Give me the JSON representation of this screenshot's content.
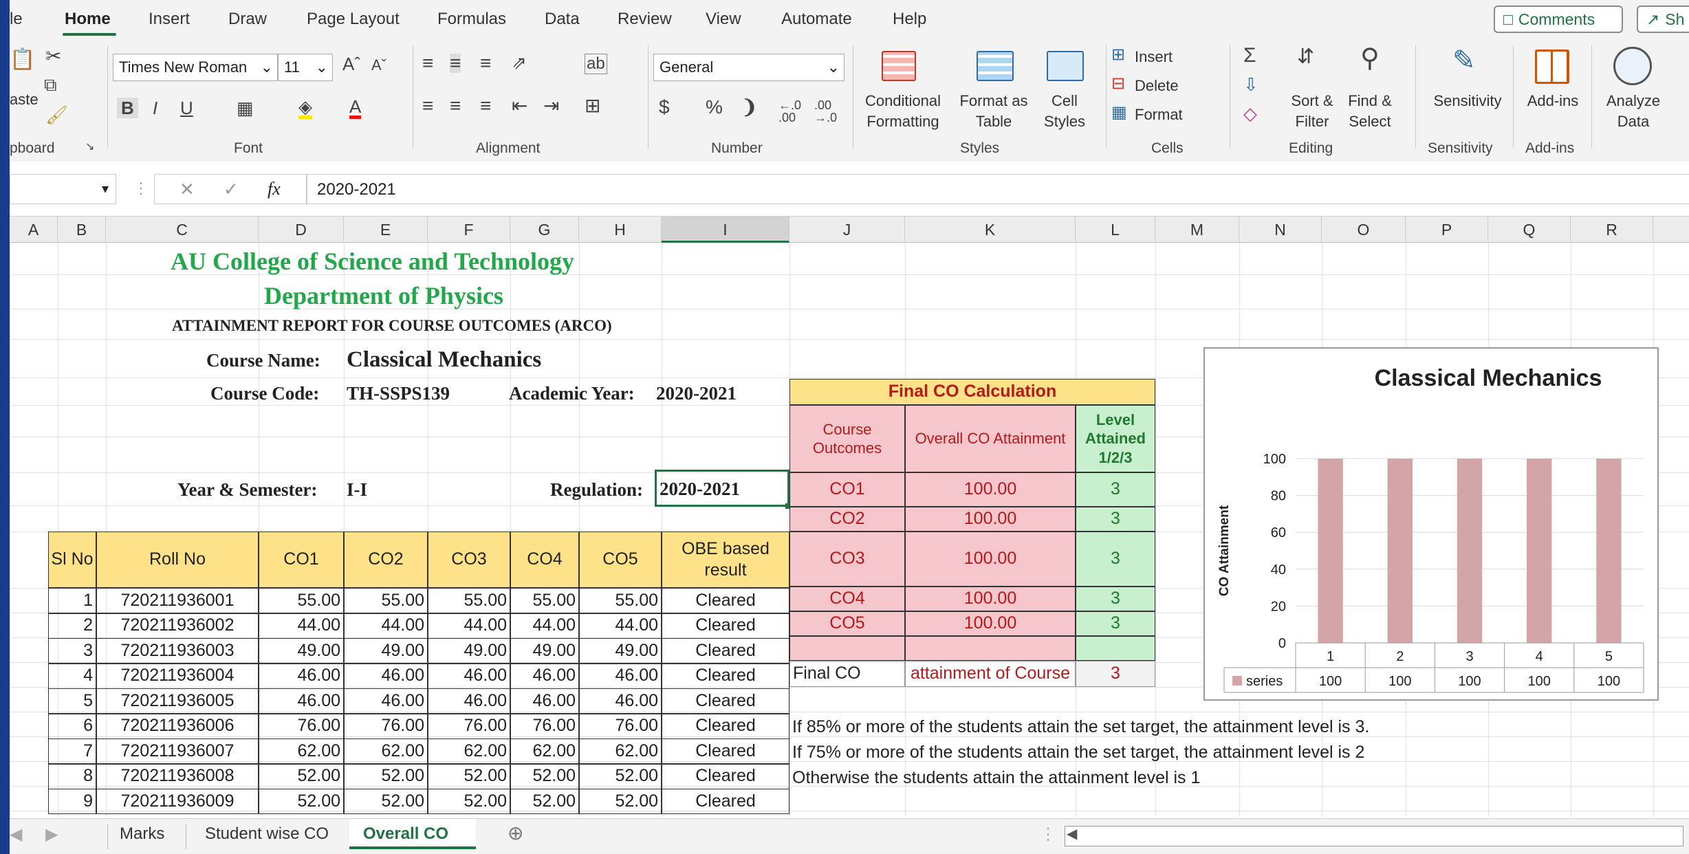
{
  "ribbon_tabs": [
    "le",
    "Home",
    "Insert",
    "Draw",
    "Page Layout",
    "Formulas",
    "Data",
    "Review",
    "View",
    "Automate",
    "Help"
  ],
  "top_buttons": {
    "comments": "Comments",
    "share": "Sh"
  },
  "font": {
    "name": "Times New Roman",
    "size": "11"
  },
  "number_format": "General",
  "groups": {
    "clipboard": "pboard",
    "font": "Font",
    "alignment": "Alignment",
    "number": "Number",
    "styles": "Styles",
    "cells": "Cells",
    "editing": "Editing",
    "sensitivity": "Sensitivity",
    "addins": "Add-ins"
  },
  "ribbon_buttons": {
    "paste": "aste",
    "cond1": "Conditional",
    "cond2": "Formatting",
    "fmt_table1": "Format as",
    "fmt_table2": "Table",
    "cell_styles1": "Cell",
    "cell_styles2": "Styles",
    "insert": "Insert",
    "delete": "Delete",
    "format": "Format",
    "sort1": "Sort &",
    "sort2": "Filter",
    "find1": "Find &",
    "find2": "Select",
    "sensitivity": "Sensitivity",
    "addins": "Add-ins",
    "analyze1": "Analyze",
    "analyze2": "Data"
  },
  "formula": {
    "value": "2020-2021",
    "fx": "fx"
  },
  "columns": [
    "A",
    "B",
    "C",
    "D",
    "E",
    "F",
    "G",
    "H",
    "I",
    "J",
    "K",
    "L",
    "M",
    "N",
    "O",
    "P",
    "Q",
    "R"
  ],
  "header": {
    "college": "AU College of Science and Technology",
    "dept": "Department of Physics",
    "report": "ATTAINMENT REPORT FOR COURSE OUTCOMES (ARCO)",
    "course_name_label": "Course Name:",
    "course_name": "Classical Mechanics",
    "course_code_label": "Course Code:",
    "course_code": "TH-SSPS139",
    "academic_year_label": "Academic Year:",
    "academic_year": "2020-2021",
    "year_sem_label": "Year & Semester:",
    "year_sem": "I-I",
    "regulation_label": "Regulation:",
    "regulation": "2020-2021"
  },
  "table_headers": [
    "Sl No",
    "Roll No",
    "CO1",
    "CO2",
    "CO3",
    "CO4",
    "CO5",
    "OBE based result"
  ],
  "students": [
    {
      "sl": "1",
      "roll": "720211936001",
      "co": [
        "55.00",
        "55.00",
        "55.00",
        "55.00",
        "55.00"
      ],
      "result": "Cleared"
    },
    {
      "sl": "2",
      "roll": "720211936002",
      "co": [
        "44.00",
        "44.00",
        "44.00",
        "44.00",
        "44.00"
      ],
      "result": "Cleared"
    },
    {
      "sl": "3",
      "roll": "720211936003",
      "co": [
        "49.00",
        "49.00",
        "49.00",
        "49.00",
        "49.00"
      ],
      "result": "Cleared"
    },
    {
      "sl": "4",
      "roll": "720211936004",
      "co": [
        "46.00",
        "46.00",
        "46.00",
        "46.00",
        "46.00"
      ],
      "result": "Cleared"
    },
    {
      "sl": "5",
      "roll": "720211936005",
      "co": [
        "46.00",
        "46.00",
        "46.00",
        "46.00",
        "46.00"
      ],
      "result": "Cleared"
    },
    {
      "sl": "6",
      "roll": "720211936006",
      "co": [
        "76.00",
        "76.00",
        "76.00",
        "76.00",
        "76.00"
      ],
      "result": "Cleared"
    },
    {
      "sl": "7",
      "roll": "720211936007",
      "co": [
        "62.00",
        "62.00",
        "62.00",
        "62.00",
        "62.00"
      ],
      "result": "Cleared"
    },
    {
      "sl": "8",
      "roll": "720211936008",
      "co": [
        "52.00",
        "52.00",
        "52.00",
        "52.00",
        "52.00"
      ],
      "result": "Cleared"
    },
    {
      "sl": "9",
      "roll": "720211936009",
      "co": [
        "52.00",
        "52.00",
        "52.00",
        "52.00",
        "52.00"
      ],
      "result": "Cleared"
    }
  ],
  "final": {
    "title": "Final CO Calculation",
    "h1": "Course Outcomes",
    "h2": "Overall CO Attainment",
    "h3": "Level Attained 1/2/3",
    "rows": [
      {
        "co": "CO1",
        "att": "100.00",
        "lvl": "3"
      },
      {
        "co": "CO2",
        "att": "100.00",
        "lvl": "3"
      },
      {
        "co": "CO3",
        "att": "100.00",
        "lvl": "3"
      },
      {
        "co": "CO4",
        "att": "100.00",
        "lvl": "3"
      },
      {
        "co": "CO5",
        "att": "100.00",
        "lvl": "3"
      }
    ],
    "final_label": "Final CO",
    "final_text": "attainment of Course",
    "final_value": "3"
  },
  "notes": [
    "If 85% or more of the students attain the set target, the attainment level is 3.",
    "If 75% or more of the students attain the set target, the attainment level is 2",
    "Otherwise the students attain the attainment level is 1"
  ],
  "chart": {
    "title": "Classical Mechanics",
    "ylabel": "CO Attainment",
    "series_name": "series",
    "categories": [
      "1",
      "2",
      "3",
      "4",
      "5"
    ],
    "values": [
      100,
      100,
      100,
      100,
      100
    ],
    "value_labels": [
      "100",
      "100",
      "100",
      "100",
      "100"
    ],
    "yticks": [
      "0",
      "20",
      "40",
      "60",
      "80",
      "100"
    ],
    "ymax": 100,
    "bar_color": "#d4a5a8"
  },
  "sheet_tabs": [
    "Marks",
    "Student wise CO",
    "Overall CO"
  ],
  "active_sheet": "Overall CO"
}
